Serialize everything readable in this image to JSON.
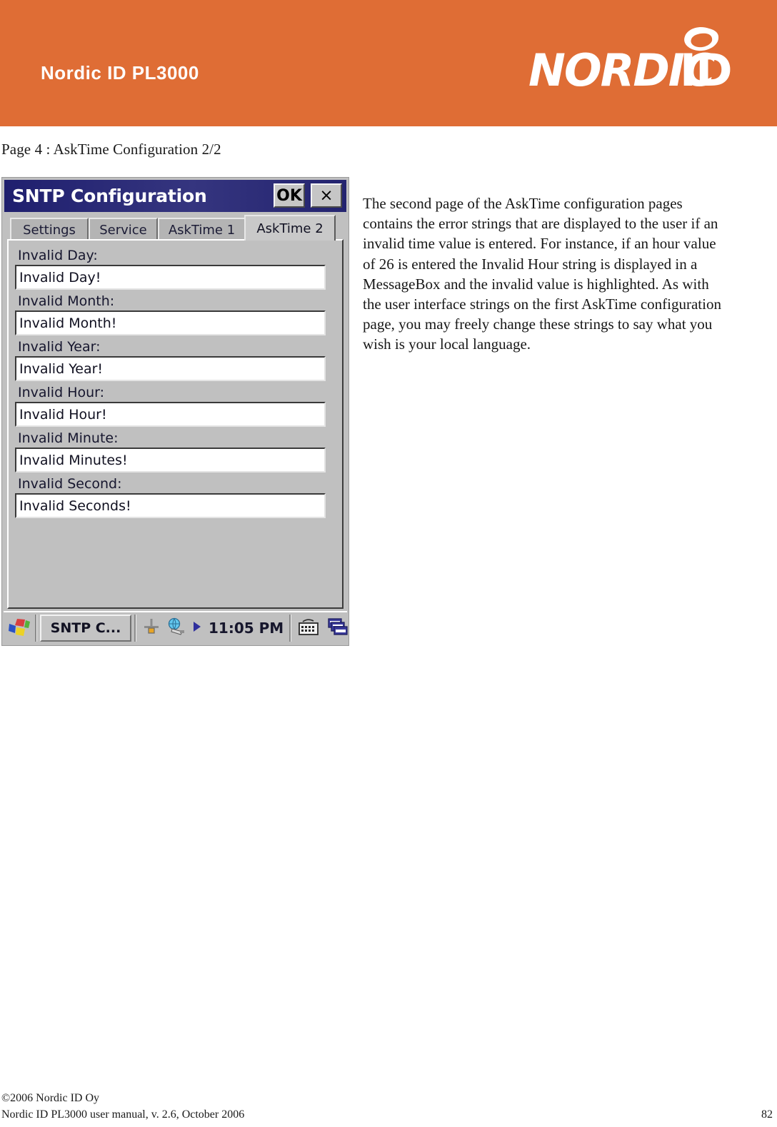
{
  "header": {
    "product_title": "Nordic ID PL3000",
    "brand_logo_text": "NORDIC ID",
    "banner_color": "#df6d35"
  },
  "page_heading": "Page 4 : AskTime Configuration 2/2",
  "screenshot": {
    "dialog": {
      "title": "SNTP Configuration",
      "ok_label": "OK",
      "close_label": "×",
      "tabs": [
        {
          "label": "Settings",
          "active": false
        },
        {
          "label": "Service",
          "active": false
        },
        {
          "label": "AskTime 1",
          "active": false
        },
        {
          "label": "AskTime 2",
          "active": true
        }
      ],
      "fields": [
        {
          "label": "Invalid Day:",
          "value": "Invalid Day!"
        },
        {
          "label": "Invalid Month:",
          "value": "Invalid Month!"
        },
        {
          "label": "Invalid Year:",
          "value": "Invalid Year!"
        },
        {
          "label": "Invalid Hour:",
          "value": "Invalid Hour!"
        },
        {
          "label": "Invalid Minute:",
          "value": "Invalid Minutes!"
        },
        {
          "label": "Invalid Second:",
          "value": "Invalid Seconds!"
        }
      ]
    },
    "taskbar": {
      "start_icon": "windows-start-icon",
      "window_button_label": "SNTP C...",
      "tray_icons": [
        "network-antenna-icon",
        "network-globe-icon",
        "play-triangle-icon"
      ],
      "clock": "11:05 PM",
      "extra_icons": [
        "keyboard-icon",
        "cascade-windows-icon"
      ]
    }
  },
  "body_paragraph": "The second page of the AskTime configuration pages contains the error strings that are displayed to the user if an invalid time value is entered. For instance, if an hour value of 26 is entered the Invalid Hour string is displayed in a MessageBox and the invalid value is highlighted. As with the user interface strings on the first AskTime configuration page, you may freely change these strings to say what you wish is your local language.",
  "footer": {
    "copyright": "©2006 Nordic ID Oy",
    "manual_line": "Nordic ID PL3000 user manual, v. 2.6, October 2006",
    "page_number": "82"
  }
}
